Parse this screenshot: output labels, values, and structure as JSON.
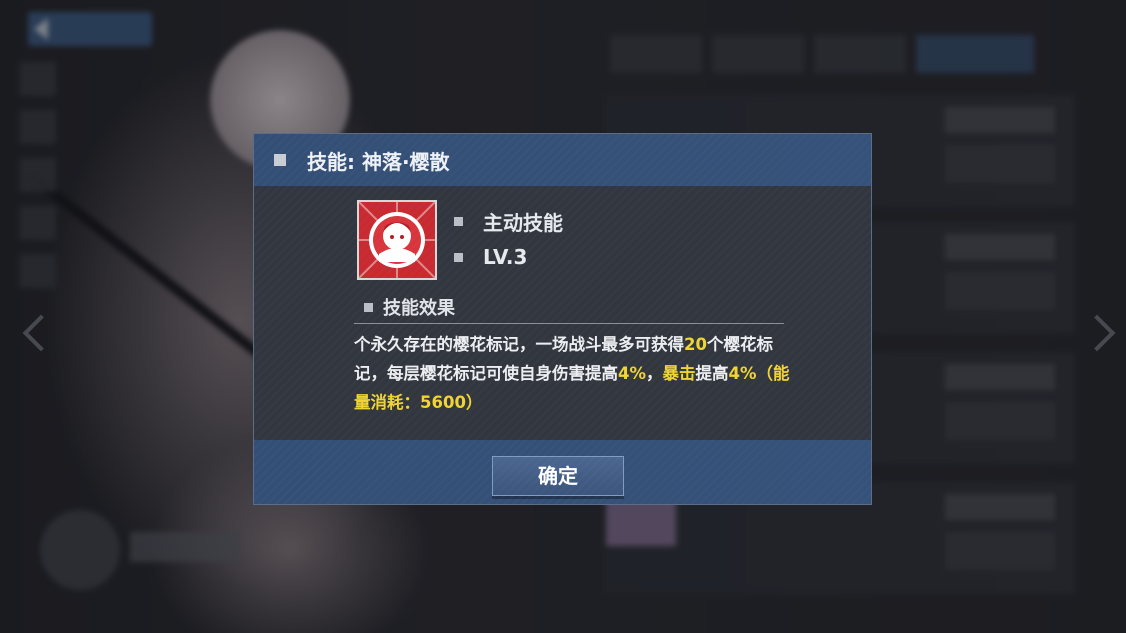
{
  "dialog": {
    "title": "技能: 神落·樱散",
    "skill_type": "主动技能",
    "level": "LV.3",
    "effect_heading": "技能效果",
    "description": {
      "p1": "个永久存在的樱花标记，一场战斗最多可获得",
      "v1": "20",
      "p2": "个樱花标记，每层樱花标记可使自身伤害提高",
      "v2": "4%",
      "p3": "，",
      "v3": "暴击",
      "p4": "提高",
      "v4": "4%",
      "v5": "（能量消耗：5600）"
    },
    "confirm_label": "确定",
    "skill_icon": "skill-portrait-icon"
  },
  "colors": {
    "header_blue": "#36527a",
    "dialog_bg": "#32363e",
    "highlight_yellow": "#f0d434",
    "icon_red": "#c82a31"
  }
}
